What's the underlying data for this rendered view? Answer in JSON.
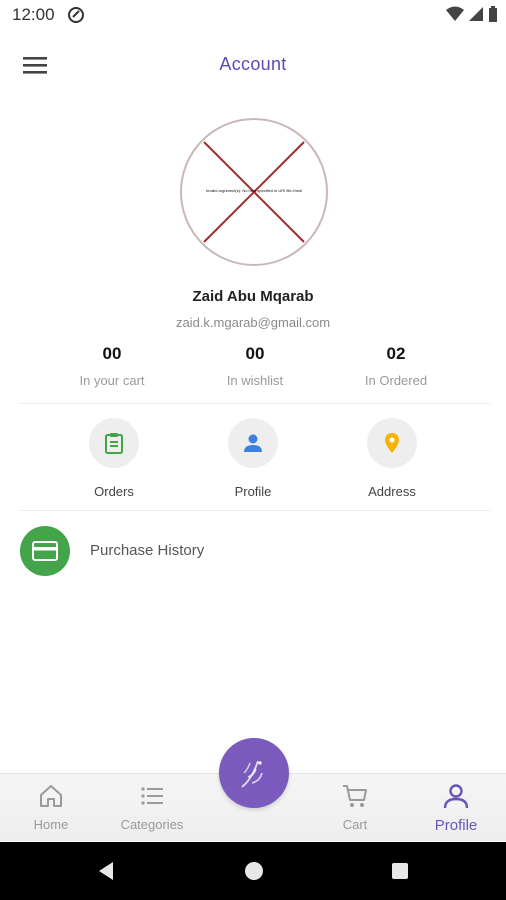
{
  "status_bar": {
    "time": "12:00"
  },
  "header": {
    "title": "Account"
  },
  "profile": {
    "avatar_error": "Invalid argument(s): No host specified in URI file:///null",
    "name": "Zaid Abu Mqarab",
    "email": "zaid.k.mgarab@gmail.com"
  },
  "stats": [
    {
      "value": "00",
      "label": "In your cart"
    },
    {
      "value": "00",
      "label": "In wishlist"
    },
    {
      "value": "02",
      "label": "In Ordered"
    }
  ],
  "quick_actions": [
    {
      "label": "Orders",
      "icon": "clipboard-icon",
      "color": "#43a449"
    },
    {
      "label": "Profile",
      "icon": "person-icon",
      "color": "#3b82e0"
    },
    {
      "label": "Address",
      "icon": "location-pin-icon",
      "color": "#f4b400"
    }
  ],
  "purchase_history": {
    "label": "Purchase History",
    "icon": "credit-card-icon",
    "color": "#43a449"
  },
  "bottom_nav": {
    "items": [
      {
        "label": "Home",
        "icon": "home-icon",
        "active": false
      },
      {
        "label": "Categories",
        "icon": "list-icon",
        "active": false
      },
      {
        "label": "Cart",
        "icon": "cart-icon",
        "active": false
      },
      {
        "label": "Profile",
        "icon": "person-outline-icon",
        "active": true
      }
    ],
    "center_button_icon": "brand-logo-icon"
  },
  "colors": {
    "accent": "#5e4ab5",
    "fab": "#7a5bbd",
    "active_nav": "#6a55b9"
  }
}
